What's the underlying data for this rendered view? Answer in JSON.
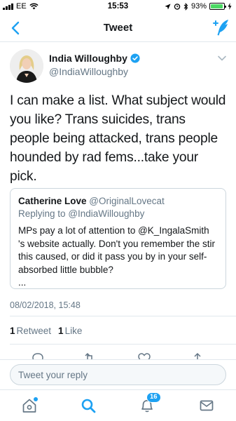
{
  "status_bar": {
    "carrier": "EE",
    "time": "15:53",
    "battery_percent": "93%",
    "battery_level": 0.93,
    "battery_color": "#4cd964"
  },
  "nav": {
    "title": "Tweet",
    "back_icon": "chevron-left-icon",
    "compose_icon": "compose-tweet-icon"
  },
  "tweet": {
    "author_name": "India Willoughby",
    "author_handle": "@IndiaWilloughby",
    "verified": true,
    "text": "I can make a list. What subject would you like? Trans suicides, trans people being attacked, trans people hounded by rad fems...take your pick.",
    "timestamp": "08/02/2018, 15:48",
    "retweet_count": "1",
    "retweet_label": "Retweet",
    "like_count": "1",
    "like_label": "Like"
  },
  "quoted_tweet": {
    "author_name": "Catherine Love",
    "author_handle": "@OriginalLovecat",
    "replying_prefix": "Replying to",
    "replying_handle": "@IndiaWilloughby",
    "text": "MPs pay a lot of attention to @K_IngalaSmith 's website actually. Don't you remember the stir this caused, or did it pass you by in your self-absorbed little bubble?",
    "ellipsis": "..."
  },
  "reply_bar": {
    "placeholder": "Tweet your reply"
  },
  "tab_bar": {
    "notifications_badge": "16",
    "icons": [
      "home-icon",
      "search-icon",
      "notifications-icon",
      "messages-icon"
    ]
  },
  "colors": {
    "accent": "#1da1f2",
    "text_primary": "#14171a",
    "text_secondary": "#657786",
    "border": "#e1e8ed"
  }
}
